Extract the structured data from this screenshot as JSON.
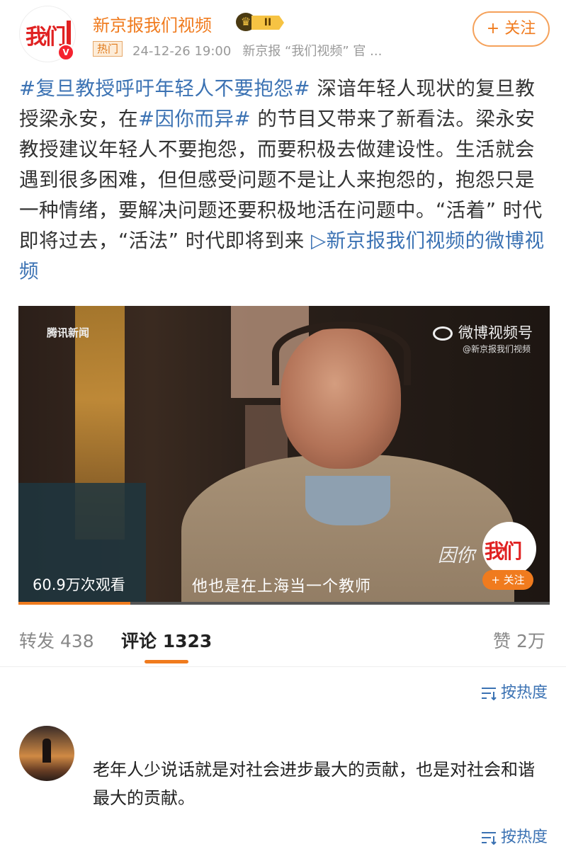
{
  "author": {
    "name": "新京报我们视频",
    "avatar_text": "我们",
    "vip_level": "II",
    "hot_tag": "热门",
    "time": "24-12-26 19:00",
    "source": "新京报 “我们视频” 官 ...",
    "follow_label": "+ 关注"
  },
  "post": {
    "segments": [
      {
        "type": "tag",
        "text": "#复旦教授呼吁年轻人不要抱怨#"
      },
      {
        "type": "text",
        "text": " 深谙年轻人现状的复旦教授梁永安，在"
      },
      {
        "type": "tag",
        "text": "#因你而异#"
      },
      {
        "type": "text",
        "text": " 的节目又带来了新看法。梁永安教授建议年轻人不要抱怨，而要积极去做建设性。生活就会遇到很多困难，但但感受问题不是让人来抱怨的，抱怨只是一种情绪，要解决问题还要积极地活在问题中。“活着” 时代即将过去，“活法” 时代即将到来 "
      },
      {
        "type": "link",
        "text": "▷新京报我们视频的微博视频"
      }
    ]
  },
  "video": {
    "watermark_left": "腾讯新闻",
    "watermark_right": "微博视频号",
    "watermark_right_sub": "@新京报我们视频",
    "channel_logo_text": "我们",
    "channel_script": "因你",
    "channel_follow": "+ 关注",
    "views": "60.9万次观看",
    "subtitle": "他也是在上海当一个教师",
    "progress_fraction": 0.21
  },
  "tabs": {
    "repost": "转发 438",
    "comment": "评论 1323",
    "like": "赞 2万"
  },
  "sort_label": "按热度",
  "comment": {
    "text": "老年人少说话就是对社会进步最大的贡献，也是对社会和谐最大的贡献。"
  },
  "colors": {
    "accent": "#f07b1e",
    "link": "#3b72b3"
  }
}
